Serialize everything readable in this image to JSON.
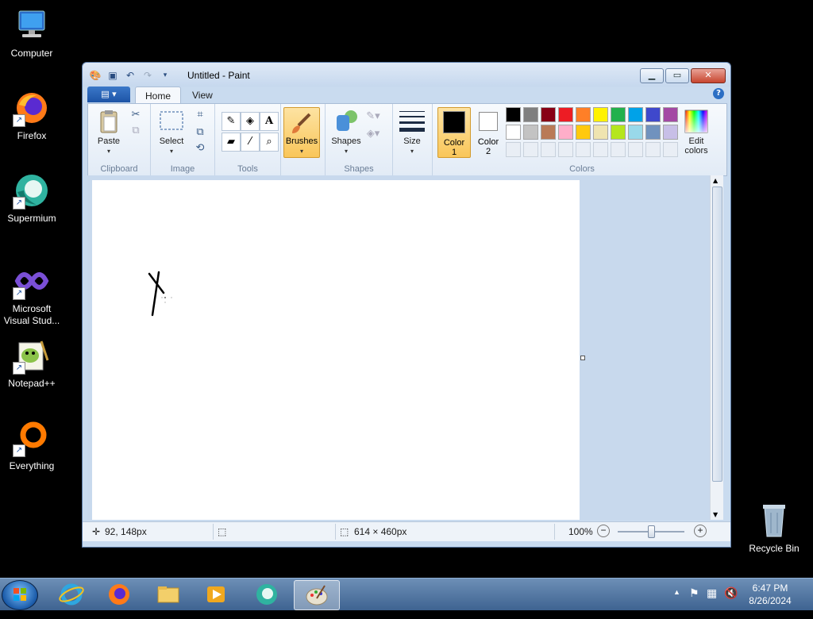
{
  "desktop": {
    "icons": [
      {
        "label": "Computer"
      },
      {
        "label": "Firefox"
      },
      {
        "label": "Supermium"
      },
      {
        "label": "Microsoft Visual Stud..."
      },
      {
        "label": "Notepad++"
      },
      {
        "label": "Everything"
      },
      {
        "label": "Recycle Bin"
      }
    ]
  },
  "window": {
    "title": "Untitled - Paint",
    "tabs": [
      "Home",
      "View"
    ],
    "help": "?"
  },
  "ribbon": {
    "clipboard": {
      "label": "Clipboard",
      "paste": "Paste"
    },
    "image": {
      "label": "Image",
      "select": "Select"
    },
    "tools": {
      "label": "Tools",
      "text_tool": "A"
    },
    "brushes": {
      "label": "Brushes"
    },
    "shapes": {
      "label": "Shapes",
      "shapes_btn": "Shapes"
    },
    "size": {
      "label": "Size"
    },
    "colors": {
      "label": "Colors",
      "color1_line1": "Color",
      "color1_line2": "1",
      "color2_line1": "Color",
      "color2_line2": "2",
      "edit_line1": "Edit",
      "edit_line2": "colors",
      "color1_value": "#000000",
      "color2_value": "#ffffff",
      "palette_row1": [
        "#000000",
        "#7f7f7f",
        "#880015",
        "#ed1c24",
        "#ff7f27",
        "#fff200",
        "#22b14c",
        "#00a2e8",
        "#3f48cc",
        "#a349a4"
      ],
      "palette_row2": [
        "#ffffff",
        "#c3c3c3",
        "#b97a57",
        "#ffaec9",
        "#ffc90e",
        "#efe4b0",
        "#b5e61d",
        "#99d9ea",
        "#7092be",
        "#c8bfe7"
      ]
    }
  },
  "statusbar": {
    "cursor_pos": "92, 148px",
    "image_size": "614 × 460px",
    "zoom": "100%",
    "zoom_level": 1.0
  },
  "taskbar": {
    "time": "6:47 PM",
    "date": "8/26/2024"
  }
}
